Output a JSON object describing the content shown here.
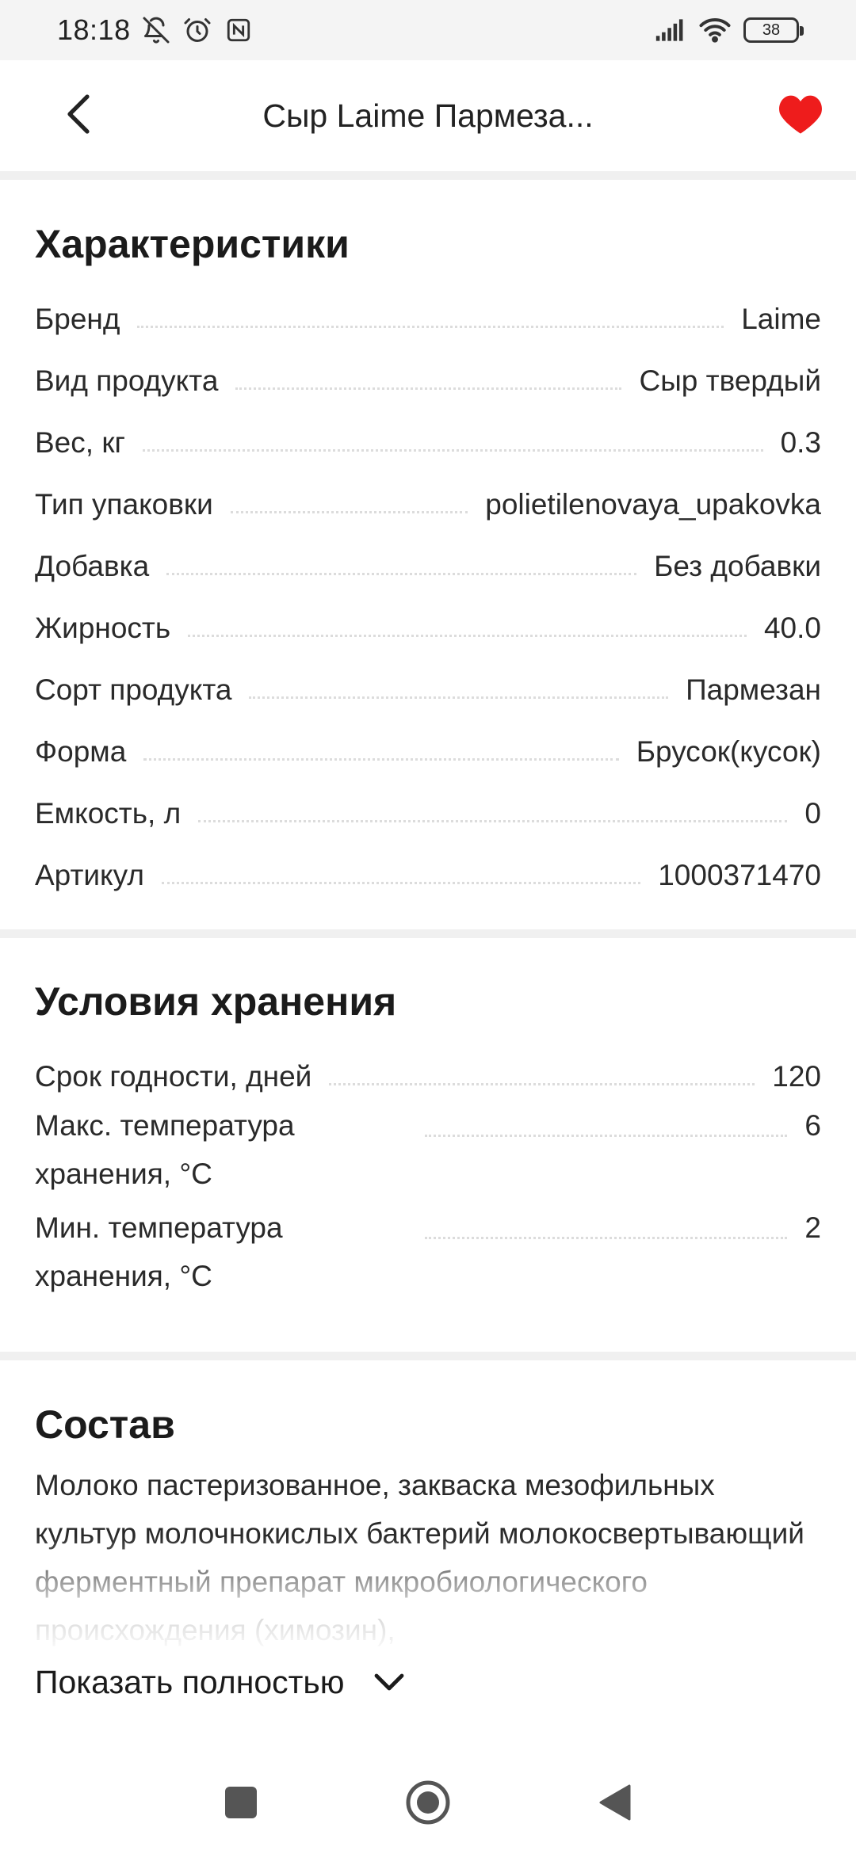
{
  "status_bar": {
    "time": "18:18",
    "battery": "38",
    "icons": [
      "bell-off-icon",
      "alarm-icon",
      "nfc-icon",
      "signal-icon",
      "wifi-icon",
      "battery-icon"
    ]
  },
  "header": {
    "title": "Сыр Laime Пармеза...",
    "back_icon": "chevron-left-icon",
    "favorite_icon": "heart-icon",
    "favorite_color": "#ee1c1c"
  },
  "characteristics": {
    "title": "Характеристики",
    "rows": [
      {
        "label": "Бренд",
        "value": "Laime"
      },
      {
        "label": "Вид продукта",
        "value": "Сыр твердый"
      },
      {
        "label": "Вес, кг",
        "value": "0.3"
      },
      {
        "label": "Тип упаковки",
        "value": "polietilenovaya_upakovka"
      },
      {
        "label": "Добавка",
        "value": "Без добавки"
      },
      {
        "label": "Жирность",
        "value": "40.0"
      },
      {
        "label": "Сорт продукта",
        "value": "Пармезан"
      },
      {
        "label": "Форма",
        "value": "Брусок(кусок)"
      },
      {
        "label": "Емкость, л",
        "value": "0"
      },
      {
        "label": "Артикул",
        "value": "1000371470"
      }
    ]
  },
  "storage": {
    "title": "Условия хранения",
    "rows": [
      {
        "label": "Срок годности, дней",
        "value": "120"
      },
      {
        "label": "Макс. температура хранения, °C",
        "value": "6"
      },
      {
        "label": "Мин. температура хранения, °C",
        "value": "2"
      }
    ]
  },
  "composition": {
    "title": "Состав",
    "text": "Молоко пастеризованное, закваска мезофильных культур молочнокислых бактерий молокосвертывающий ферментный препарат микробиологического происхождения (химозин),",
    "show_more_label": "Показать полностью",
    "show_more_icon": "chevron-down-icon"
  },
  "nav_bar": {
    "icons": [
      "recents-square-icon",
      "home-circle-icon",
      "back-triangle-icon"
    ]
  }
}
